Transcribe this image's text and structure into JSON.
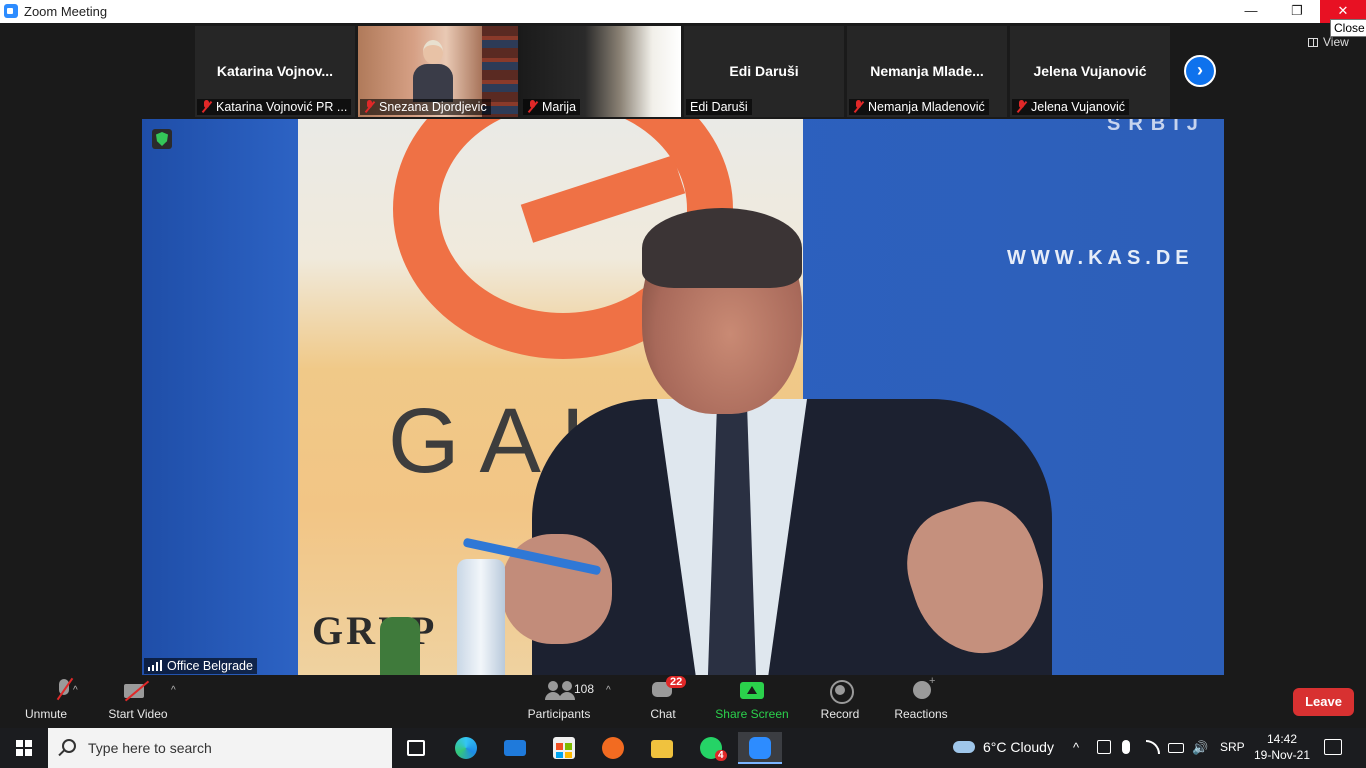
{
  "window": {
    "title": "Zoom Meeting",
    "minimize_icon": "minimize-icon",
    "minimize_glyph": "—",
    "restore_glyph": "❐",
    "close_glyph": "✕",
    "close_tooltip": "Close"
  },
  "gallery": {
    "tiles": [
      {
        "display_name": "Katarina  Vojnov...",
        "label": "Katarina Vojnović PR ..."
      },
      {
        "display_name": "",
        "label": "Snezana Djordjevic"
      },
      {
        "display_name": "",
        "label": "Marija"
      },
      {
        "display_name": "Edi Daruši",
        "label": "Edi Daruši"
      },
      {
        "display_name": "Nemanja  Mlade...",
        "label": "Nemanja Mladenović"
      },
      {
        "display_name": "Jelena Vujanović",
        "label": "Jelena Vujanović"
      }
    ],
    "next_glyph": "›",
    "view_label": "View"
  },
  "main_video": {
    "label": "Office Belgrade",
    "logo_text": "GAL",
    "logo_sub": "GRUP",
    "banner_url": "WWW.KAS.DE",
    "banner_top": "SRBIJ"
  },
  "toolbar": {
    "unmute": "Unmute",
    "start_video": "Start Video",
    "participants": "Participants",
    "participants_count": "108",
    "chat": "Chat",
    "chat_badge": "22",
    "share_screen": "Share Screen",
    "record": "Record",
    "reactions": "Reactions",
    "leave": "Leave",
    "caret": "^",
    "share_color": "#2bd14c",
    "leave_color": "#d83131"
  },
  "taskbar": {
    "search_placeholder": "Type here to search",
    "whatsapp_badge": "4",
    "weather": "6°C  Cloudy",
    "tray_chevron": "^",
    "language": "SRP",
    "time": "14:42",
    "date": "19-Nov-21"
  }
}
